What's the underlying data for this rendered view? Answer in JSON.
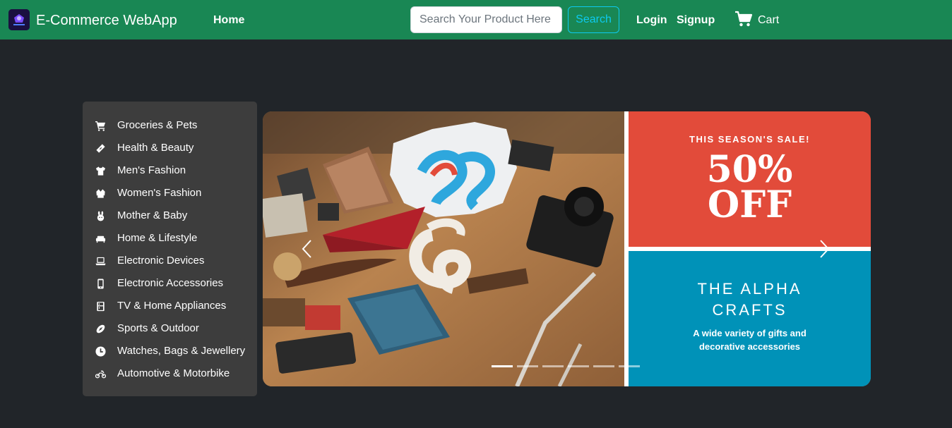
{
  "navbar": {
    "brand_title": "E-Commerce WebApp",
    "home_label": "Home",
    "search": {
      "placeholder": "Search Your Product Here",
      "value": "",
      "button_label": "Search"
    },
    "login_label": "Login",
    "signup_label": "Signup",
    "cart_label": "Cart",
    "background_color": "#198754",
    "search_button_color": "#0dcaf0"
  },
  "sidebar": {
    "background_color": "#3d3d3d",
    "items": [
      {
        "label": "Groceries & Pets",
        "icon": "cart-icon"
      },
      {
        "label": "Health & Beauty",
        "icon": "bandage-icon"
      },
      {
        "label": "Men's Fashion",
        "icon": "tshirt-icon"
      },
      {
        "label": "Women's Fashion",
        "icon": "blouse-icon"
      },
      {
        "label": "Mother & Baby",
        "icon": "baby-icon"
      },
      {
        "label": "Home & Lifestyle",
        "icon": "sofa-icon"
      },
      {
        "label": "Electronic Devices",
        "icon": "laptop-icon"
      },
      {
        "label": "Electronic Accessories",
        "icon": "phone-icon"
      },
      {
        "label": "TV & Home Appliances",
        "icon": "appliance-icon"
      },
      {
        "label": "Sports & Outdoor",
        "icon": "football-icon"
      },
      {
        "label": "Watches, Bags & Jewellery",
        "icon": "clock-icon"
      },
      {
        "label": "Automotive & Motorbike",
        "icon": "motorbike-icon"
      }
    ]
  },
  "carousel": {
    "slide": {
      "sale_kicker": "THIS SEASON'S SALE!",
      "sale_line1": "50%",
      "sale_line2": "OFF",
      "brand_line1": "THE ALPHA",
      "brand_line2": "CRAFTS",
      "description": "A wide variety of gifts and decorative accessories",
      "sale_color": "#e24b3a",
      "brand_color": "#0092b8"
    },
    "indicator_count": 6,
    "active_index": 0
  }
}
